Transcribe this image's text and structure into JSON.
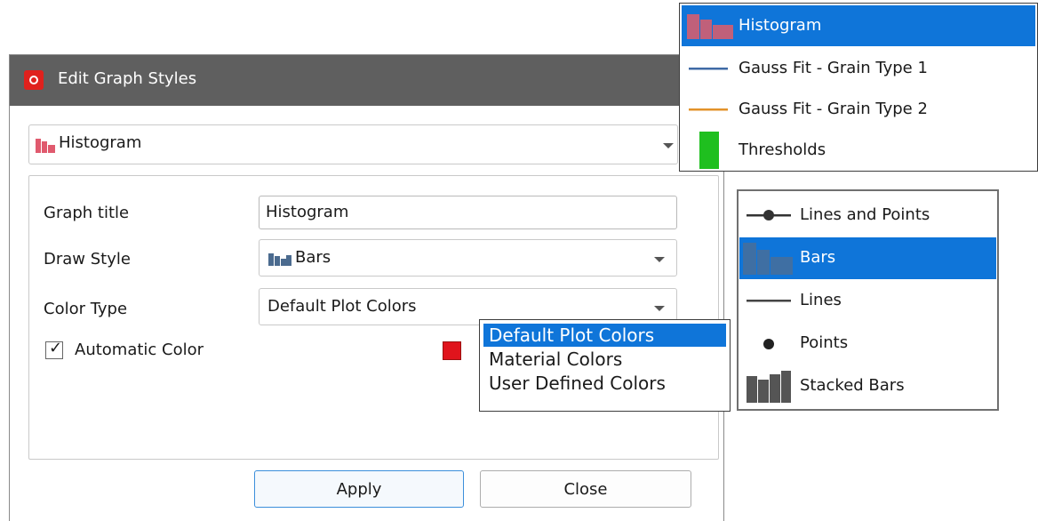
{
  "dialog": {
    "title": "Edit Graph Styles",
    "graph_selector": {
      "value": "Histogram",
      "icon": "histogram-bars-icon"
    },
    "fields": {
      "graph_title": {
        "label": "Graph title",
        "value": "Histogram"
      },
      "draw_style": {
        "label": "Draw Style",
        "value": "Bars",
        "icon": "bars-icon"
      },
      "color_type": {
        "label": "Color Type",
        "value": "Default Plot Colors"
      },
      "automatic_color": {
        "label": "Automatic Color",
        "checked": true,
        "check_glyph": "✓",
        "swatch_color": "#e0141c"
      }
    },
    "buttons": {
      "apply": "Apply",
      "close": "Close"
    }
  },
  "color_type_popup": {
    "options": [
      "Default Plot Colors",
      "Material Colors",
      "User Defined Colors"
    ],
    "selected_index": 0
  },
  "graph_popup": {
    "items": [
      {
        "label": "Histogram",
        "icon": "histogram-bars-icon",
        "selected": true
      },
      {
        "label": "Gauss Fit - Grain Type 1",
        "icon": "blue-line-icon",
        "color": "#3f6aa6"
      },
      {
        "label": "Gauss Fit - Grain Type 2",
        "icon": "orange-line-icon",
        "color": "#e2922a"
      },
      {
        "label": "Thresholds",
        "icon": "green-bar-icon",
        "color": "#1fbf1f"
      }
    ]
  },
  "draw_style_popup": {
    "items": [
      {
        "label": "Lines and Points",
        "icon": "line-point-icon"
      },
      {
        "label": "Bars",
        "icon": "bars-icon",
        "selected": true
      },
      {
        "label": "Lines",
        "icon": "line-icon"
      },
      {
        "label": "Points",
        "icon": "point-icon"
      },
      {
        "label": "Stacked Bars",
        "icon": "stacked-bars-icon"
      }
    ]
  },
  "colors": {
    "accent": "#0f75d9",
    "titlebar": "#5f5f5f",
    "histogram": "#e05a6e"
  }
}
